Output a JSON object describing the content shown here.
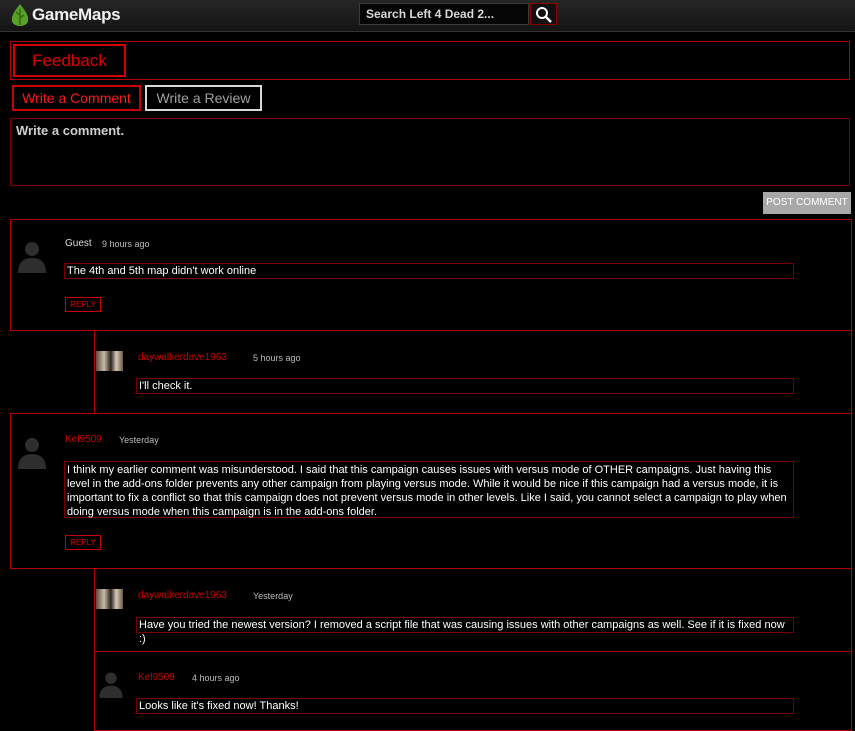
{
  "header": {
    "brand": "GameMaps",
    "search_placeholder": "Search Left 4 Dead 2...",
    "logo_icon": "leaf-logo-icon",
    "search_icon": "search-icon"
  },
  "section": {
    "title": "Feedback"
  },
  "tabs": {
    "comment": "Write a Comment",
    "review": "Write a Review"
  },
  "composer": {
    "placeholder": "Write a comment.",
    "post_label": "POST COMMENT"
  },
  "reply_label": "REPLY",
  "comments": [
    {
      "author": "Guest",
      "time": "9 hours ago",
      "text": "The 4th and 5th map didn't work online",
      "replies": [
        {
          "author": "daywalkerdave1963",
          "time": "5 hours ago",
          "text": "I'll check it."
        }
      ]
    },
    {
      "author": "Kel9509",
      "time": "Yesterday",
      "text": "I think my earlier comment was misunderstood. I said that this campaign causes issues with versus mode of OTHER campaigns. Just having this level in the add-ons folder prevents any other campaign from playing versus mode. While it would be nice if this campaign had a versus mode, it is important to fix a conflict so that this campaign does not prevent versus mode in other levels. Like I said, you cannot select a campaign to play when doing versus mode when this campaign is in the add-ons folder.",
      "replies": [
        {
          "author": "daywalkerdave1963",
          "time": "Yesterday",
          "text": "Have you tried the newest version? I removed a script file that was causing issues with other campaigns as well. See if it is fixed now :)"
        },
        {
          "author": "Kel9509",
          "time": "4 hours ago",
          "text": "Looks like it's fixed now! Thanks!"
        }
      ]
    }
  ],
  "colors": {
    "accent": "#c80000",
    "background": "#000000"
  }
}
